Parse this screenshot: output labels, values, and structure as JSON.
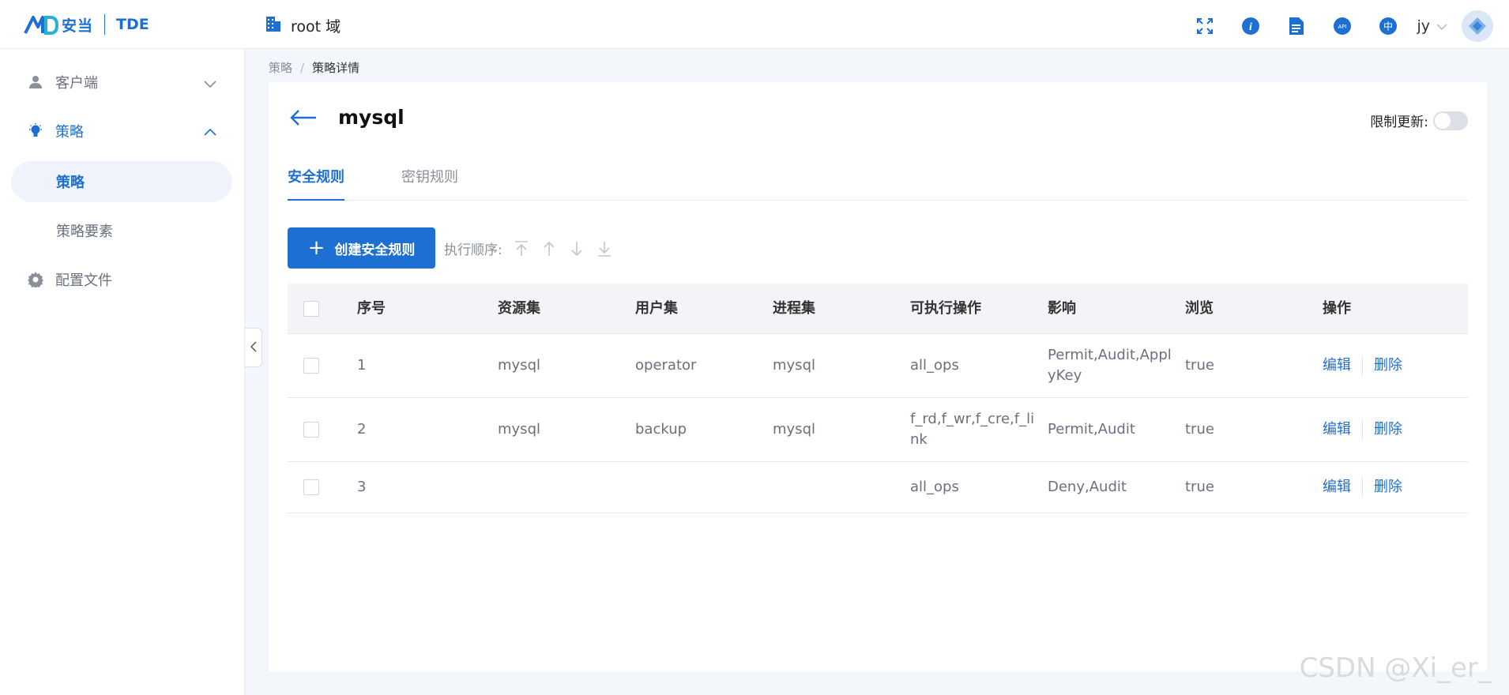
{
  "header": {
    "brand_cn": "安当",
    "brand_product": "TDE",
    "domain_label": "root 域",
    "user_name": "jy",
    "icons": [
      "fullscreen-icon",
      "info-icon",
      "document-icon",
      "api-icon",
      "language-icon"
    ],
    "lang_label": "中",
    "api_label": "API"
  },
  "sidebar": {
    "items": [
      {
        "label": "客户端",
        "icon": "user-icon",
        "expanded": false
      },
      {
        "label": "策略",
        "icon": "lightbulb-icon",
        "expanded": true
      },
      {
        "label": "配置文件",
        "icon": "gear-icon",
        "expanded": false
      }
    ],
    "sub_items": [
      {
        "label": "策略",
        "active": true
      },
      {
        "label": "策略要素",
        "active": false
      }
    ]
  },
  "breadcrumb": {
    "parent": "策略",
    "separator": "/",
    "current": "策略详情"
  },
  "page": {
    "title": "mysql",
    "limit_update_label": "限制更新:",
    "limit_update_on": false
  },
  "tabs": [
    {
      "label": "安全规则",
      "active": true
    },
    {
      "label": "密钥规则",
      "active": false
    }
  ],
  "toolbar": {
    "create_label": "创建安全规则",
    "order_label": "执行顺序:"
  },
  "table": {
    "headers": [
      "序号",
      "资源集",
      "用户集",
      "进程集",
      "可执行操作",
      "影响",
      "浏览",
      "操作"
    ],
    "rows": [
      {
        "no": "1",
        "resource": "mysql",
        "user": "operator",
        "process": "mysql",
        "ops": "all_ops",
        "effect": "Permit,Audit,ApplyKey",
        "browse": "true"
      },
      {
        "no": "2",
        "resource": "mysql",
        "user": "backup",
        "process": "mysql",
        "ops": "f_rd,f_wr,f_cre,f_link",
        "effect": "Permit,Audit",
        "browse": "true"
      },
      {
        "no": "3",
        "resource": "",
        "user": "",
        "process": "",
        "ops": "all_ops",
        "effect": "Deny,Audit",
        "browse": "true"
      }
    ],
    "edit_label": "编辑",
    "delete_label": "删除"
  },
  "watermark": "CSDN @Xi_er_",
  "colors": {
    "accent": "#1d6fd1",
    "background": "#f3f6fb"
  }
}
